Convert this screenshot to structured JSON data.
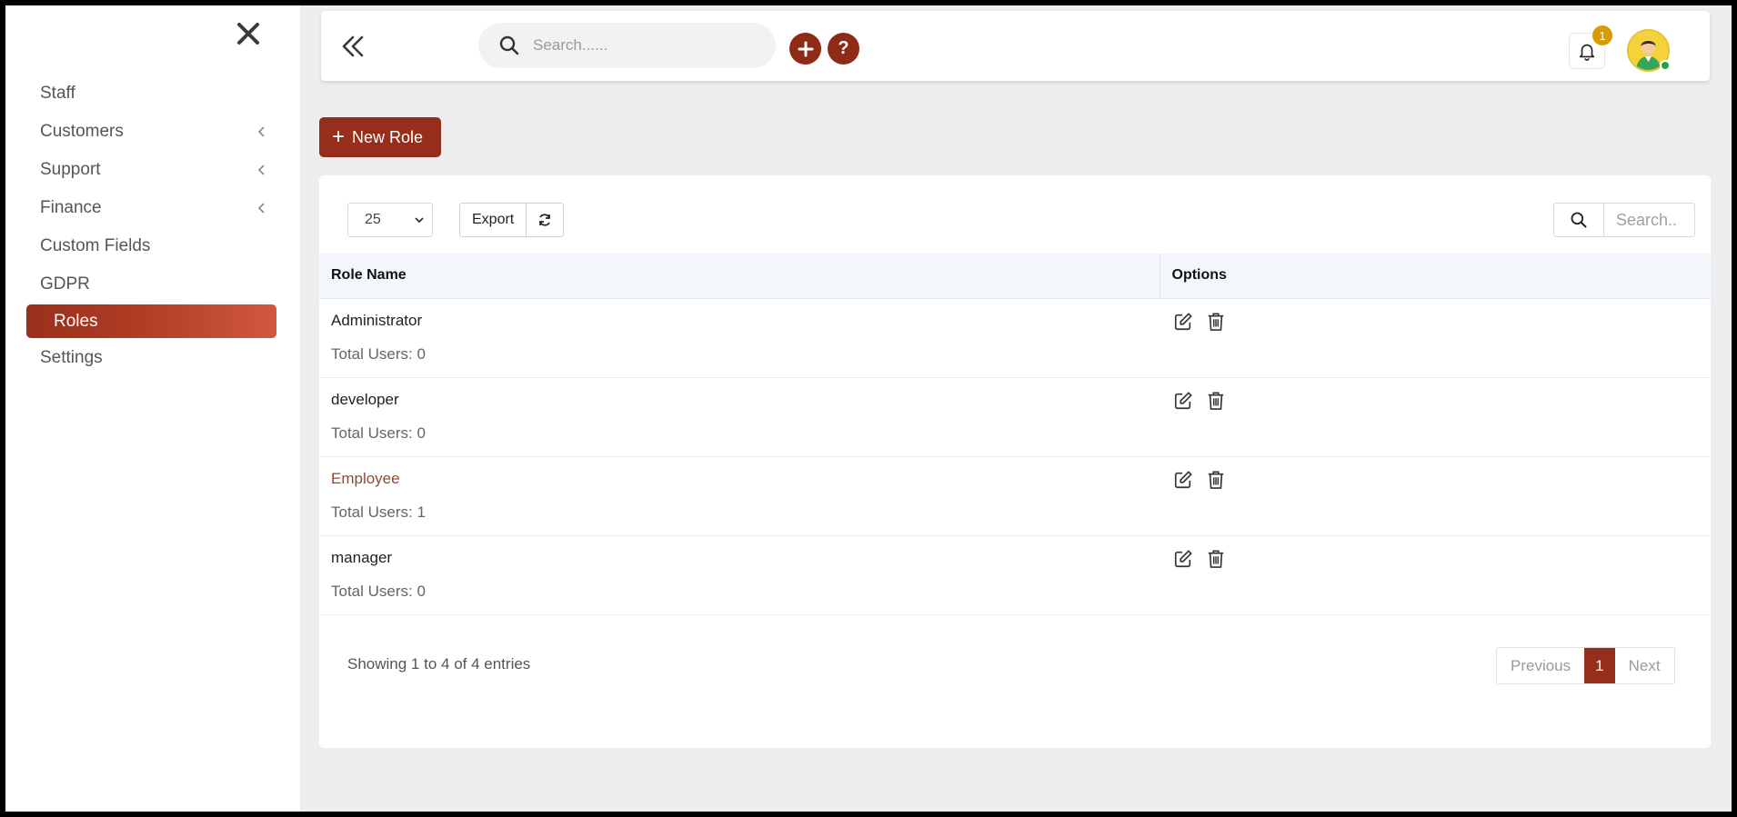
{
  "sidebar": {
    "items": [
      {
        "label": "Staff",
        "has_submenu": false
      },
      {
        "label": "Customers",
        "has_submenu": true
      },
      {
        "label": "Support",
        "has_submenu": true
      },
      {
        "label": "Finance",
        "has_submenu": true
      },
      {
        "label": "Custom Fields",
        "has_submenu": false
      },
      {
        "label": "GDPR",
        "has_submenu": false
      },
      {
        "label": "Roles",
        "has_submenu": false,
        "active": true
      },
      {
        "label": "Settings",
        "has_submenu": false
      }
    ]
  },
  "header": {
    "search_placeholder": "Search......",
    "notification_count": "1",
    "help_label": "?"
  },
  "actions": {
    "new_role_label": "New Role"
  },
  "table_controls": {
    "page_length": "25",
    "export_label": "Export",
    "search_placeholder": "Search.."
  },
  "table": {
    "columns": [
      "Role Name",
      "Options"
    ],
    "rows": [
      {
        "name": "Administrator",
        "users": "Total Users: 0"
      },
      {
        "name": "developer",
        "users": "Total Users: 0"
      },
      {
        "name": "Employee",
        "users": "Total Users: 1"
      },
      {
        "name": "manager",
        "users": "Total Users: 0"
      }
    ]
  },
  "footer": {
    "info": "Showing 1 to 4 of 4 entries",
    "previous": "Previous",
    "current_page": "1",
    "next": "Next"
  },
  "colors": {
    "accent": "#952f1b",
    "badge": "#d79b06",
    "online": "#1fa33f"
  }
}
